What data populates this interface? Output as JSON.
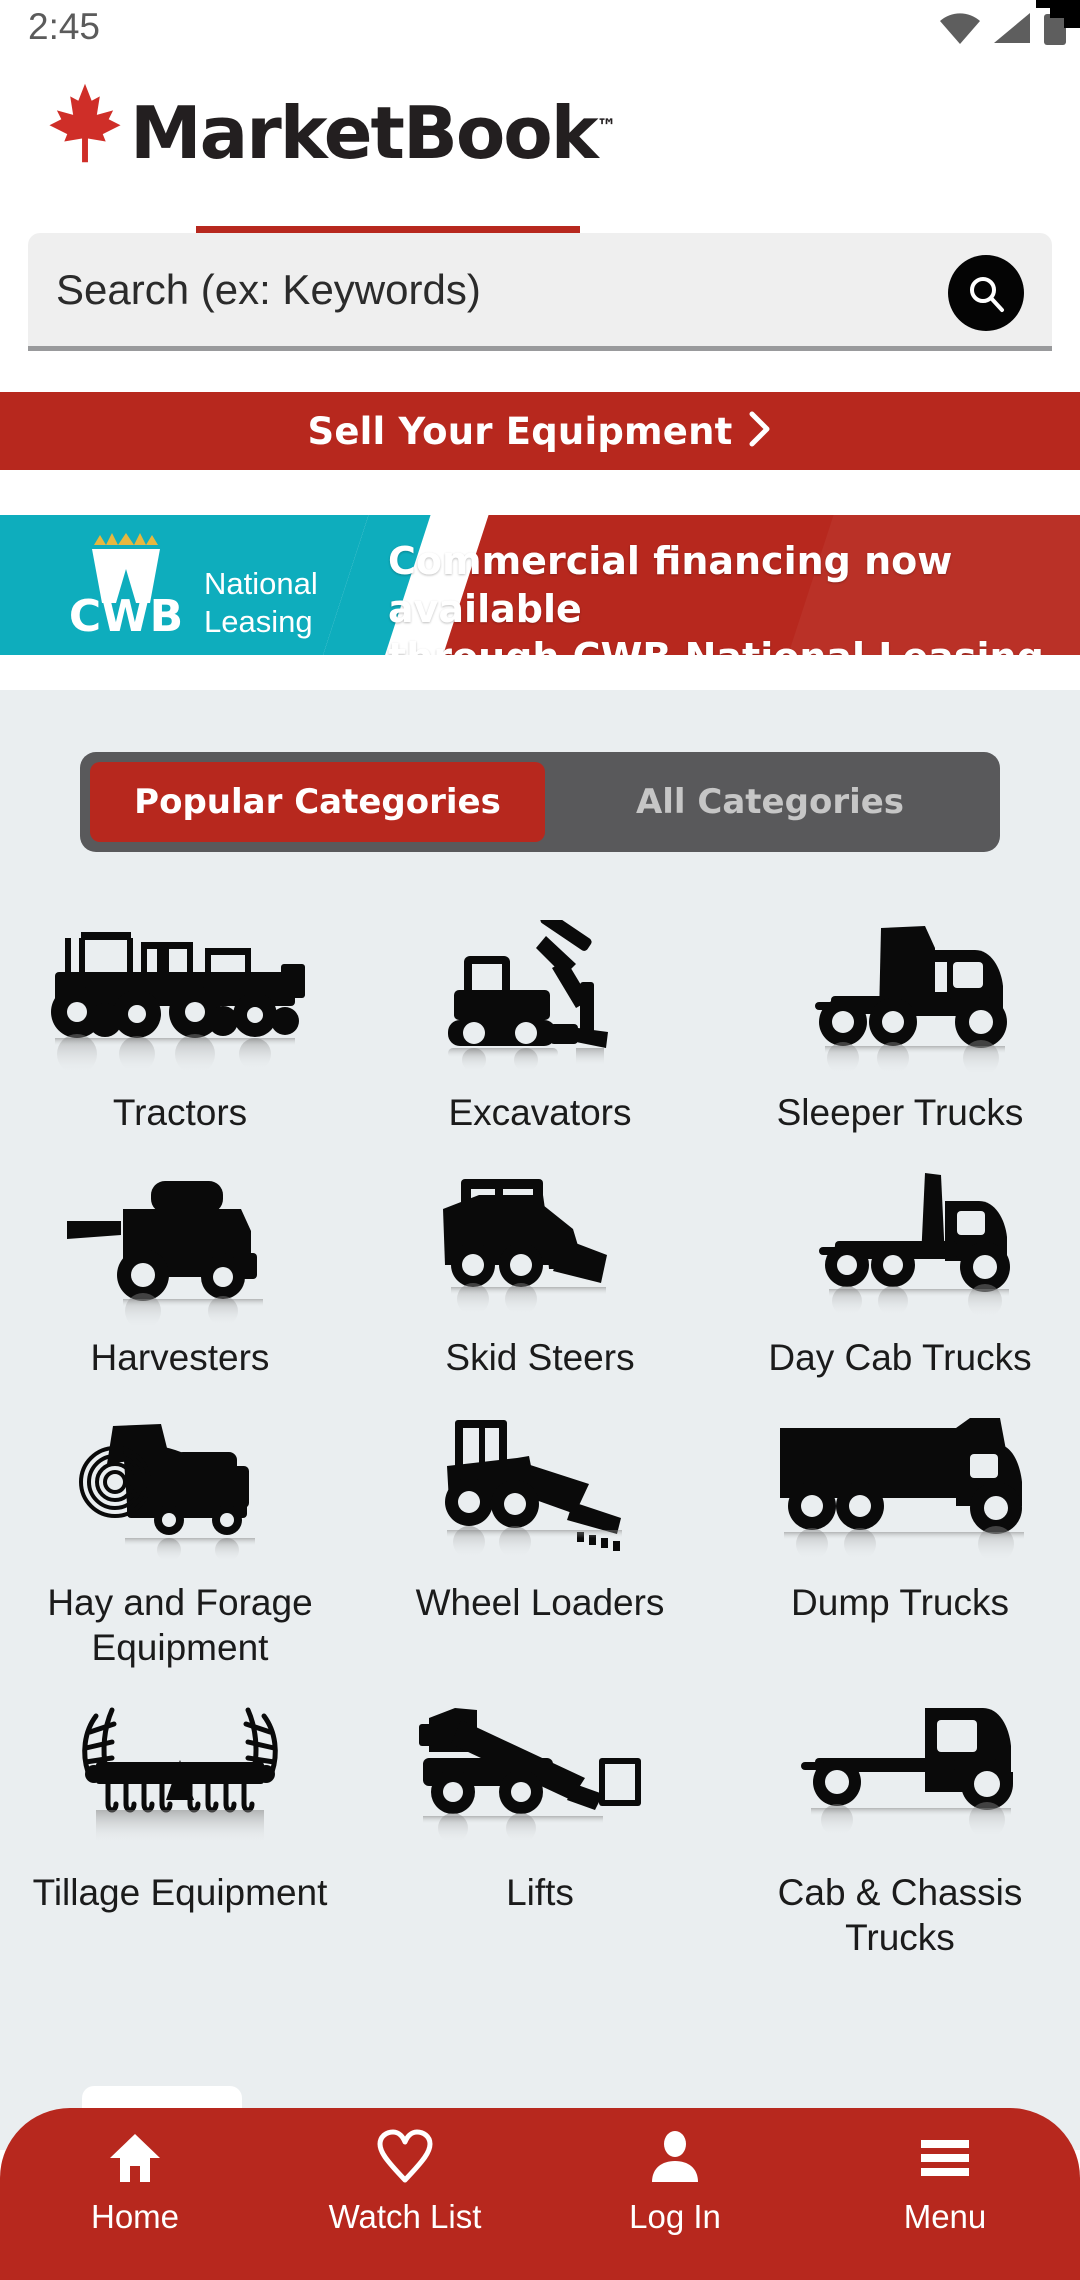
{
  "status_bar": {
    "time": "2:45",
    "icons": [
      "wifi-icon",
      "cellular-signal-icon",
      "battery-icon"
    ]
  },
  "header": {
    "logo_text": "MarketBook",
    "logo_tm": "™",
    "logo_icon": "maple-leaf-icon",
    "brand_red": "#b7281e"
  },
  "search": {
    "placeholder": "Search (ex: Keywords)",
    "value": "",
    "button_icon": "search-icon"
  },
  "sell_bar": {
    "label": "Sell Your Equipment",
    "chevron": "›"
  },
  "banner": {
    "logo_name": "CWB",
    "logo_sub": "National\nLeasing",
    "logo_sub_line1": "National",
    "logo_sub_line2": "Leasing",
    "crown_icon": "crown-w-icon",
    "headline_line1": "Commercial financing now available",
    "headline_line2": "through CWB National Leasing.",
    "teal": "#0eadbd",
    "red": "#b7281e"
  },
  "tabs": [
    {
      "label": "Popular Categories",
      "active": true
    },
    {
      "label": "All Categories",
      "active": false
    }
  ],
  "categories": [
    {
      "label": "Tractors",
      "icon": "tractors-icon"
    },
    {
      "label": "Excavators",
      "icon": "excavator-icon"
    },
    {
      "label": "Sleeper Trucks",
      "icon": "sleeper-truck-icon"
    },
    {
      "label": "Harvesters",
      "icon": "harvester-icon"
    },
    {
      "label": "Skid Steers",
      "icon": "skid-steer-icon"
    },
    {
      "label": "Day Cab Trucks",
      "icon": "day-cab-truck-icon"
    },
    {
      "label": "Hay and Forage Equipment",
      "icon": "hay-forage-icon"
    },
    {
      "label": "Wheel Loaders",
      "icon": "wheel-loader-icon"
    },
    {
      "label": "Dump Trucks",
      "icon": "dump-truck-icon"
    },
    {
      "label": "Tillage Equipment",
      "icon": "tillage-icon"
    },
    {
      "label": "Lifts",
      "icon": "lift-icon"
    },
    {
      "label": "Cab & Chassis Trucks",
      "icon": "cab-chassis-truck-icon"
    }
  ],
  "bottom_nav": [
    {
      "label": "Home",
      "icon": "home-icon",
      "active": true
    },
    {
      "label": "Watch List",
      "icon": "heart-icon",
      "active": false
    },
    {
      "label": "Log In",
      "icon": "person-icon",
      "active": false
    },
    {
      "label": "Menu",
      "icon": "hamburger-icon",
      "active": false
    }
  ]
}
